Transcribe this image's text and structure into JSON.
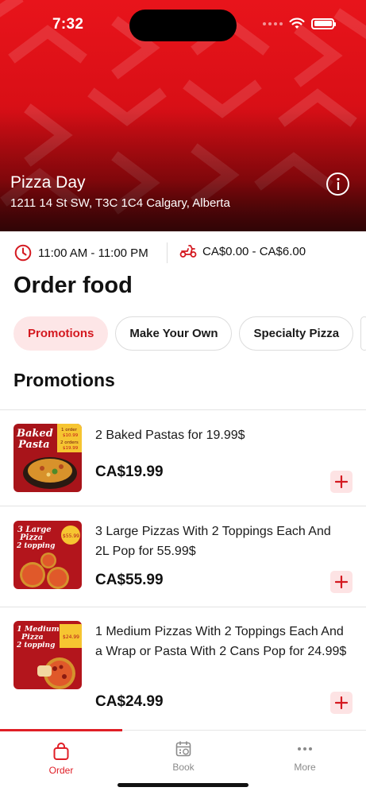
{
  "status_bar": {
    "time": "7:32"
  },
  "store": {
    "name": "Pizza Day",
    "address": "1211 14 St SW, T3C 1C4 Calgary, Alberta"
  },
  "meta": {
    "hours": "11:00 AM - 11:00 PM",
    "delivery_fee": "CA$0.00 - CA$6.00"
  },
  "page_title": "Order food",
  "categories": [
    "Promotions",
    "Make Your Own",
    "Specialty Pizza"
  ],
  "active_category": "Promotions",
  "section_title": "Promotions",
  "items": [
    {
      "name": "2 Baked Pastas for 19.99$",
      "price": "CA$19.99",
      "thumb": {
        "title1": "Baked",
        "title2": "Pasta",
        "tag1": "1 order",
        "tag2": "$10.99",
        "tag3": "2 orders",
        "tag4": "$19.99"
      }
    },
    {
      "name": "3 Large Pizzas With 2 Toppings Each And 2L Pop for 55.99$",
      "price": "CA$55.99",
      "thumb": {
        "title1": "3 Large",
        "title2": "Pizza",
        "title3": "2 topping",
        "sub": "on each and 2 Liter pop",
        "tag1": "$55.99"
      }
    },
    {
      "name": "1 Medium Pizzas With 2 Toppings Each And a Wrap or Pasta With 2 Cans Pop for 24.99$",
      "price": "CA$24.99",
      "thumb": {
        "title1": "1 Medium",
        "title2": "Pizza",
        "title3": "2 topping",
        "sub": "& wrap or pasta with 2 cans pop",
        "tag1": "$24.99",
        "tag2": "Add $3 and make it large"
      }
    }
  ],
  "tabs": [
    {
      "label": "Order",
      "icon": "bag-icon",
      "active": true
    },
    {
      "label": "Book",
      "icon": "calendar-icon",
      "active": false
    },
    {
      "label": "More",
      "icon": "more-dots-icon",
      "active": false
    }
  ],
  "colors": {
    "brand_red": "#e01e26",
    "pill_active_bg": "#fde6e7",
    "add_btn_bg": "#fde3e4"
  }
}
